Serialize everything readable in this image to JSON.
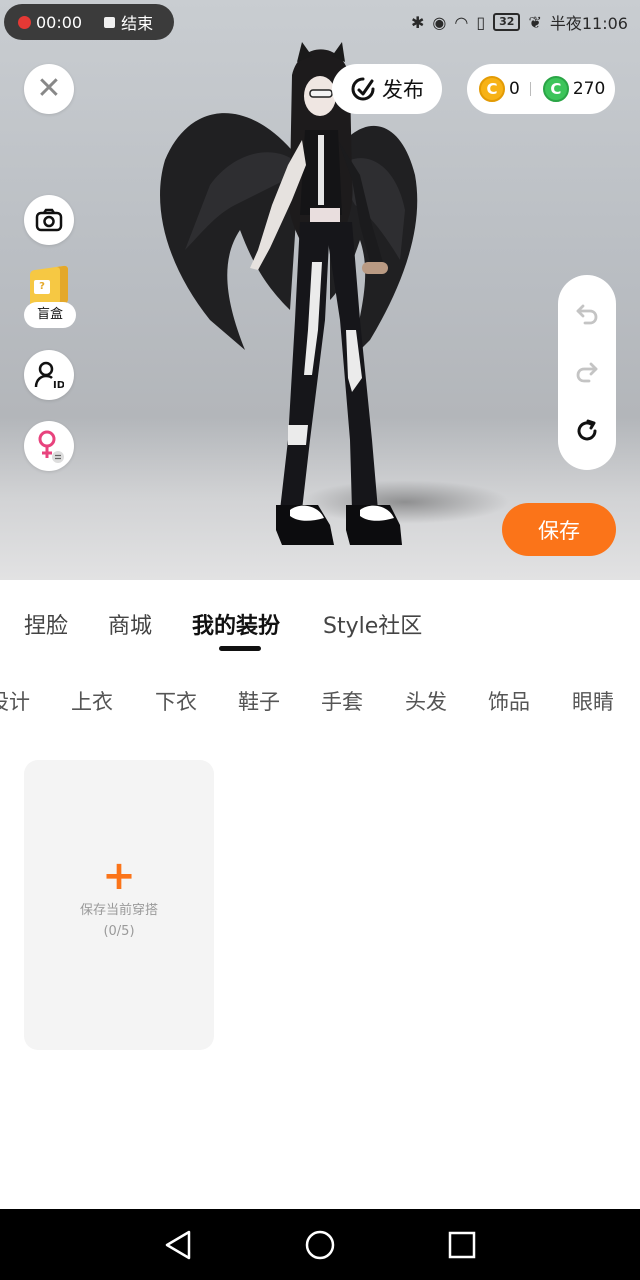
{
  "status_bar": {
    "recording_time": "00:00",
    "end_label": "结束",
    "battery": "32",
    "clock": "半夜11:06"
  },
  "header": {
    "publish_label": "发布",
    "coin_gold": "0",
    "coin_green": "270",
    "gold_coin_glyph": "C",
    "green_coin_glyph": "C"
  },
  "side_tools": {
    "blind_box_label": "盲盒",
    "blind_box_mark": "?"
  },
  "save_label": "保存",
  "tabs": [
    {
      "label": "捏脸"
    },
    {
      "label": "商城"
    },
    {
      "label": "我的装扮"
    },
    {
      "label": "Style社区"
    }
  ],
  "categories": [
    {
      "label": "设计"
    },
    {
      "label": "上衣"
    },
    {
      "label": "下衣"
    },
    {
      "label": "鞋子"
    },
    {
      "label": "手套"
    },
    {
      "label": "头发"
    },
    {
      "label": "饰品"
    },
    {
      "label": "眼睛"
    }
  ],
  "outfit_card": {
    "plus": "+",
    "line1": "保存当前穿搭",
    "line2": "(0/5)"
  },
  "colors": {
    "accent": "#fb7419",
    "gold_coin": "#f7b217",
    "green_coin": "#3cc45a"
  }
}
